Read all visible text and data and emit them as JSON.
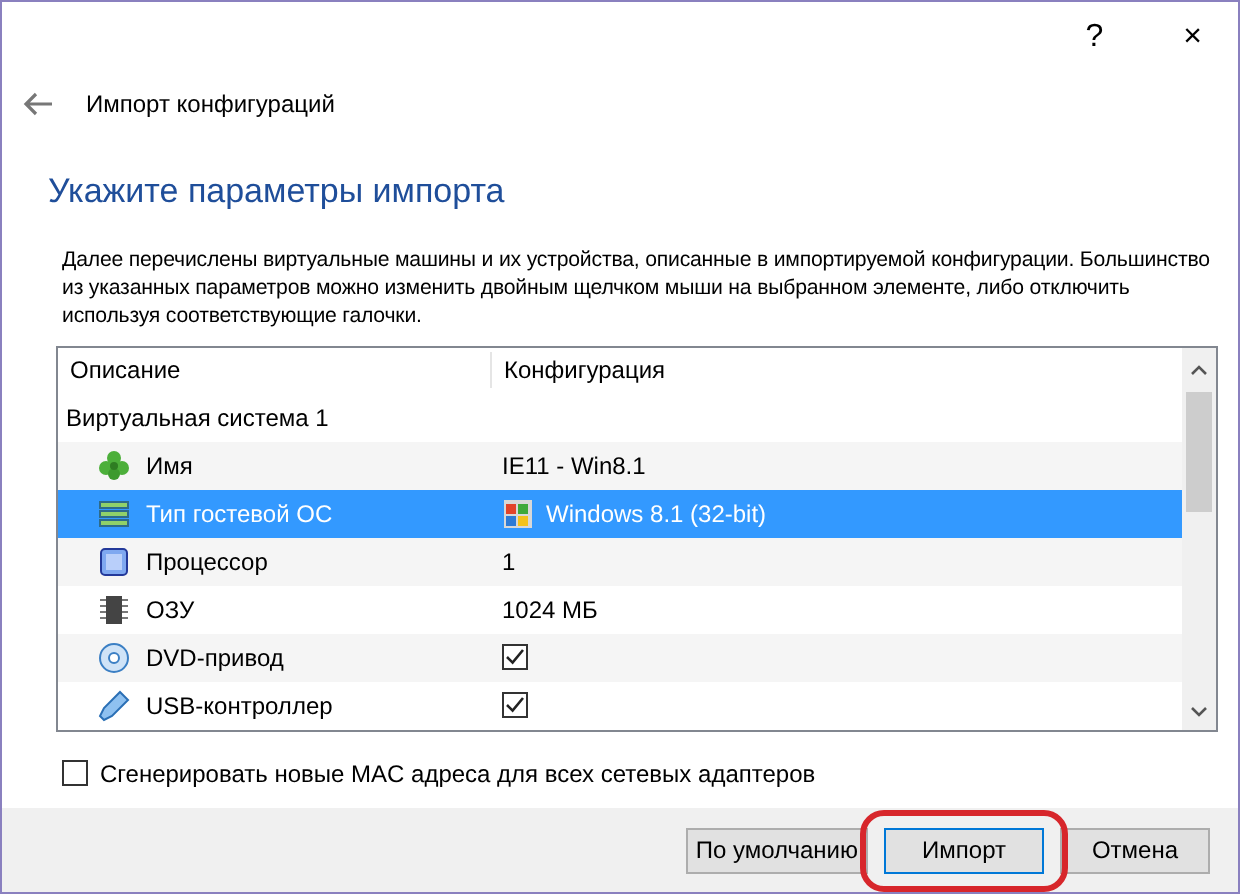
{
  "window": {
    "help": "?",
    "close": "×"
  },
  "header": {
    "title": "Импорт конфигураций"
  },
  "heading": "Укажите параметры импорта",
  "description": "Далее перечислены виртуальные машины и их устройства, описанные в импортируемой конфигурации. Большинство из указанных параметров можно изменить двойным щелчком мыши на выбранном элементе, либо отключить используя соответствующие галочки.",
  "table": {
    "columns": [
      "Описание",
      "Конфигурация"
    ],
    "group": "Виртуальная система 1",
    "rows": [
      {
        "label": "Имя",
        "kind": "text",
        "value": "IE11 - Win8.1",
        "selected": false
      },
      {
        "label": "Тип гостевой ОС",
        "kind": "os",
        "value": "Windows 8.1 (32-bit)",
        "selected": true
      },
      {
        "label": "Процессор",
        "kind": "text",
        "value": "1",
        "selected": false
      },
      {
        "label": "ОЗУ",
        "kind": "text",
        "value": "1024 МБ",
        "selected": false
      },
      {
        "label": "DVD-привод",
        "kind": "check",
        "checked": true,
        "selected": false
      },
      {
        "label": "USB-контроллер",
        "kind": "check",
        "checked": true,
        "selected": false
      }
    ]
  },
  "mac_option": {
    "label": "Сгенерировать новые MAC адреса для всех сетевых адаптеров",
    "checked": false
  },
  "buttons": [
    {
      "label": "По умолчанию",
      "highlighted": false
    },
    {
      "label": "Импорт",
      "highlighted": true
    },
    {
      "label": "Отмена",
      "highlighted": false
    }
  ]
}
